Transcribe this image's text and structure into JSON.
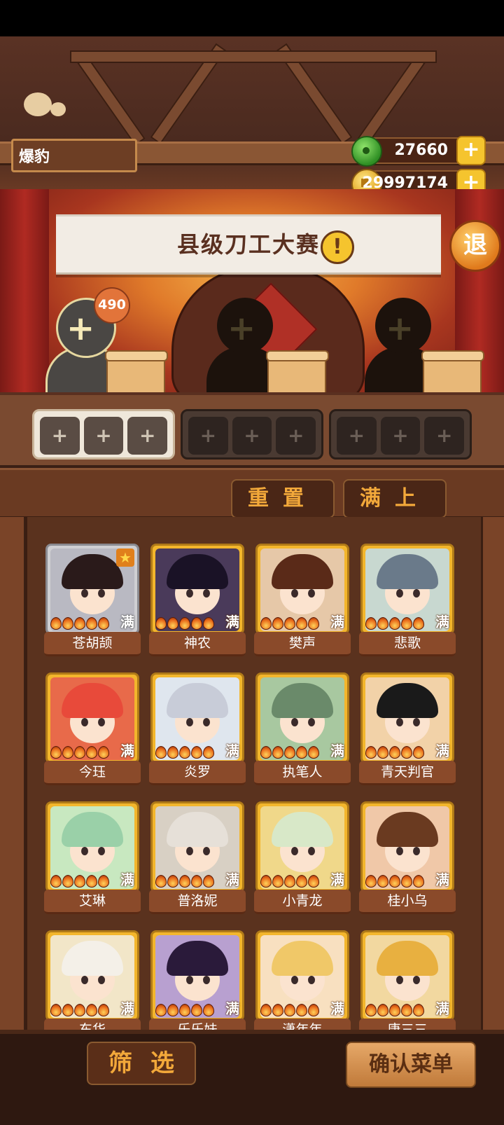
{
  "player": {
    "name": "爆豹"
  },
  "currency": {
    "jade": {
      "value": "27660",
      "icon": "jade-icon"
    },
    "coins": {
      "value": "29997174",
      "icon": "coin-icon"
    }
  },
  "event": {
    "title": "县级刀工大赛",
    "exit_label": "退"
  },
  "chef_slots": [
    {
      "plus": "+",
      "badge": "490",
      "state": "active"
    },
    {
      "plus": "+",
      "state": "locked"
    },
    {
      "plus": "+",
      "state": "locked"
    }
  ],
  "dish_slot_symbol": "+",
  "controls": {
    "reset_label": "重置",
    "fill_label": "满上"
  },
  "cards": [
    {
      "name": "苍胡颉",
      "badge": "满",
      "flames": 5,
      "frame": "grey",
      "starred": true
    },
    {
      "name": "神农",
      "badge": "满",
      "flames": 5,
      "frame": "gold"
    },
    {
      "name": "樊声",
      "badge": "满",
      "flames": 5,
      "frame": "gold"
    },
    {
      "name": "悲歌",
      "badge": "满",
      "flames": 5,
      "frame": "gold"
    },
    {
      "name": "今珏",
      "badge": "满",
      "flames": 5,
      "frame": "gold"
    },
    {
      "name": "炎罗",
      "badge": "满",
      "flames": 5,
      "frame": "gold"
    },
    {
      "name": "执笔人",
      "badge": "满",
      "flames": 5,
      "frame": "gold"
    },
    {
      "name": "青天判官",
      "badge": "满",
      "flames": 5,
      "frame": "gold"
    },
    {
      "name": "艾琳",
      "badge": "满",
      "flames": 5,
      "frame": "gold"
    },
    {
      "name": "普洛妮",
      "badge": "满",
      "flames": 5,
      "frame": "gold"
    },
    {
      "name": "小青龙",
      "badge": "满",
      "flames": 5,
      "frame": "gold"
    },
    {
      "name": "桂小乌",
      "badge": "满",
      "flames": 5,
      "frame": "gold"
    },
    {
      "name": "东华",
      "badge": "满",
      "flames": 5,
      "frame": "gold"
    },
    {
      "name": "乐乐妹",
      "badge": "满",
      "flames": 5,
      "frame": "gold"
    },
    {
      "name": "潇年年",
      "badge": "满",
      "flames": 5,
      "frame": "gold"
    },
    {
      "name": "唐三三",
      "badge": "满",
      "flames": 5,
      "frame": "gold"
    }
  ],
  "bottom": {
    "filter_label": "筛选",
    "confirm_label": "确认菜单"
  },
  "colors": {
    "gold": "#f3b62c",
    "accent_text": "#f2a83a",
    "panel": "#5a321e"
  }
}
